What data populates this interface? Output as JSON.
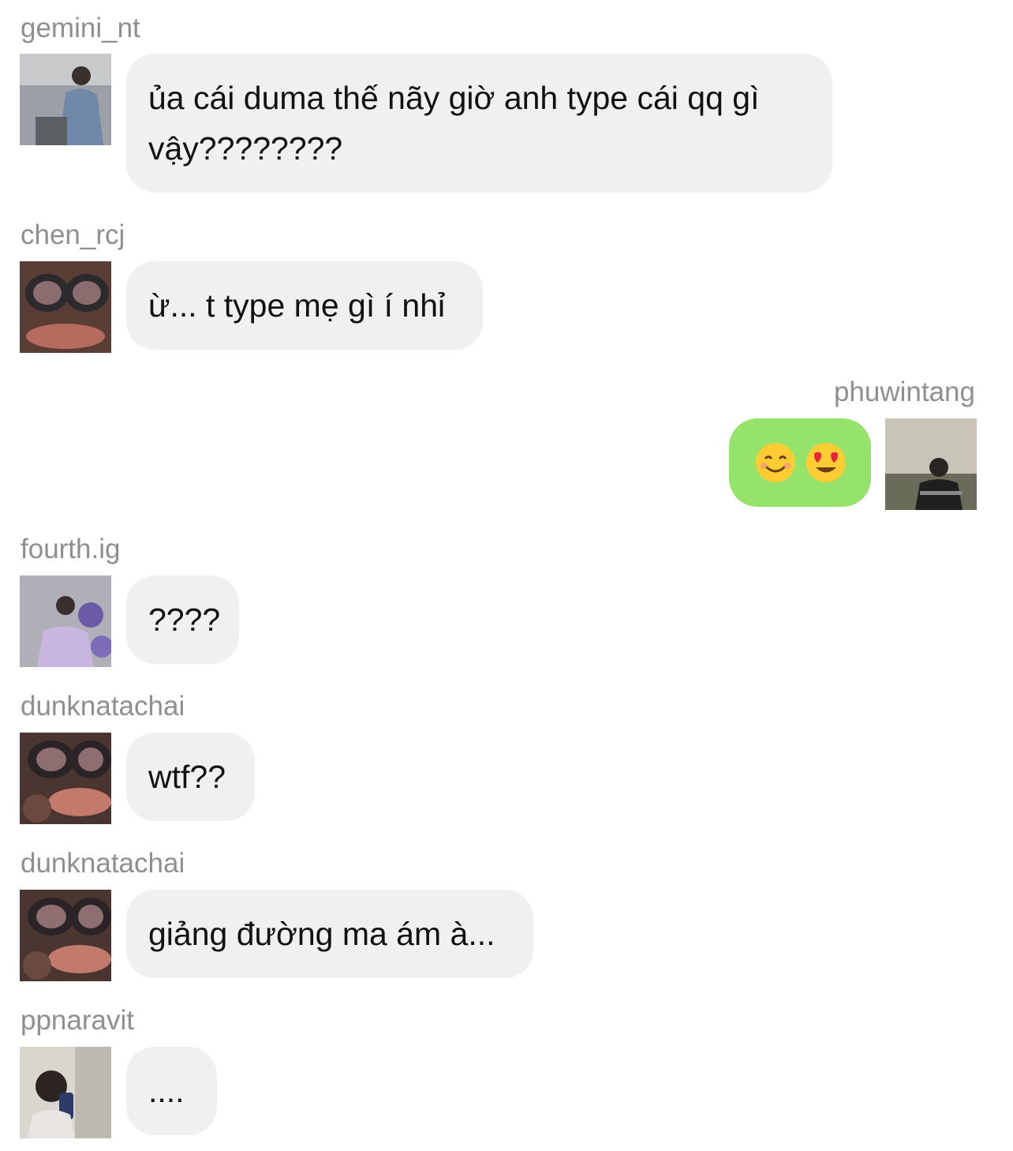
{
  "messages": [
    {
      "user": "gemini_nt",
      "text": "ủa cái duma thế nãy giờ anh type cái qq gì vậy????????"
    },
    {
      "user": "chen_rcj",
      "text": "ừ... t type mẹ gì í nhỉ"
    },
    {
      "user": "phuwintang",
      "emojis": [
        "smiling-face-icon",
        "heart-eyes-icon"
      ],
      "own": true
    },
    {
      "user": "fourth.ig",
      "text": "????"
    },
    {
      "user": "dunknatachai",
      "text": "wtf??"
    },
    {
      "user": "dunknatachai",
      "text": "giảng đường ma ám à..."
    },
    {
      "user": "ppnaravit",
      "text": "...."
    }
  ],
  "colors": {
    "incoming_bubble": "#f0f0f0",
    "outgoing_bubble": "#95e36b",
    "username": "#8e8e93"
  }
}
